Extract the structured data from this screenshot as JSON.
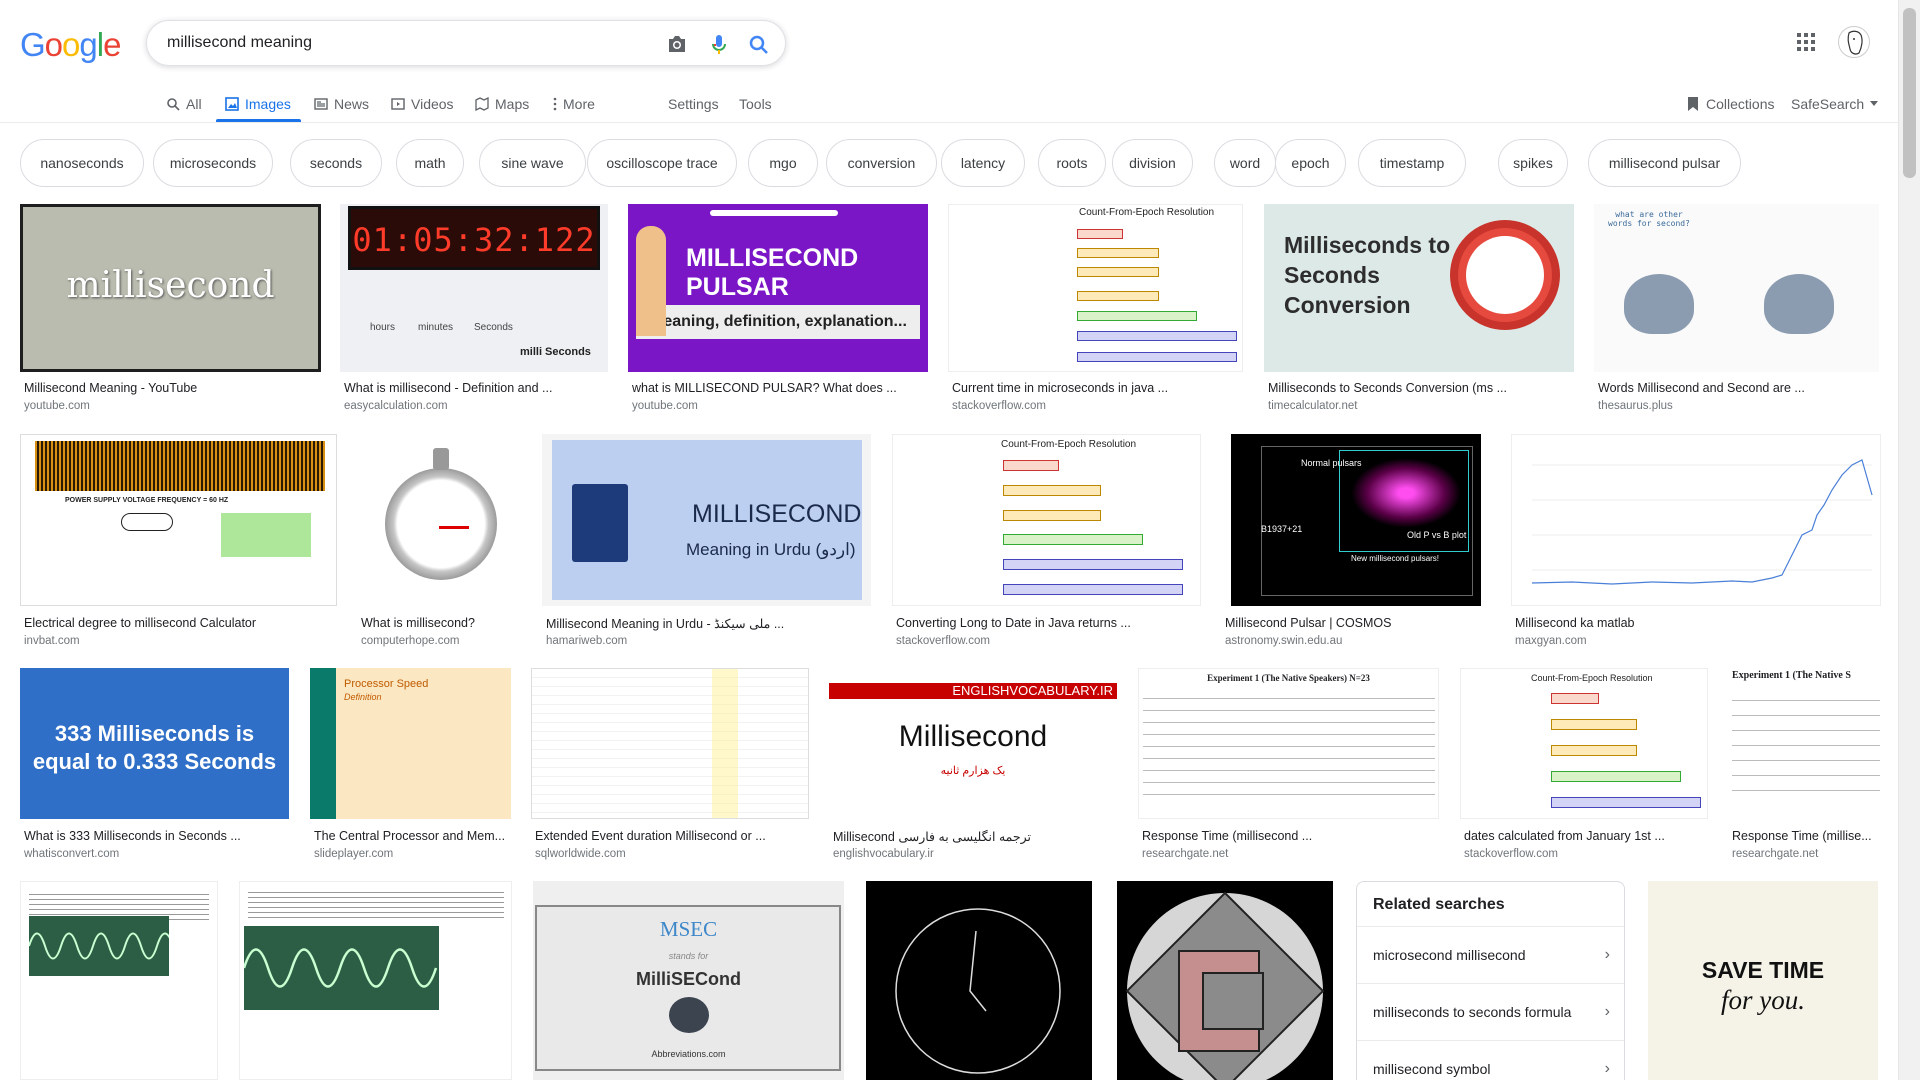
{
  "logo": {
    "text": "Google"
  },
  "search": {
    "query": "millisecond meaning"
  },
  "icons": {
    "camera": "camera-icon",
    "mic": "microphone-icon",
    "search": "search-icon",
    "apps": "apps-grid-icon"
  },
  "tabs": [
    {
      "label": "All",
      "icon": "search-icon"
    },
    {
      "label": "Images",
      "icon": "image-icon",
      "active": true
    },
    {
      "label": "News",
      "icon": "news-icon"
    },
    {
      "label": "Videos",
      "icon": "video-icon"
    },
    {
      "label": "Maps",
      "icon": "map-icon"
    },
    {
      "label": "More",
      "icon": "more-vert-icon"
    }
  ],
  "tools": {
    "settings": "Settings",
    "tools": "Tools",
    "collections": "Collections",
    "safesearch": "SafeSearch"
  },
  "chips": [
    "nanoseconds",
    "microseconds",
    "seconds",
    "math",
    "sine wave",
    "oscilloscope trace",
    "mgo",
    "conversion",
    "latency",
    "roots",
    "division",
    "word",
    "epoch",
    "timestamp",
    "spikes",
    "millisecond pulsar"
  ],
  "results": [
    {
      "caption": "Millisecond Meaning - YouTube",
      "source": "youtube.com",
      "thumb_text": "millisecond"
    },
    {
      "caption": "What is millisecond - Definition and ...",
      "source": "easycalculation.com",
      "thumb_text": "01:05:32:122",
      "sub": [
        "hours",
        "minutes",
        "Seconds",
        "milli Seconds"
      ]
    },
    {
      "caption": "what is MILLISECOND PULSAR? What does ...",
      "source": "youtube.com",
      "thumb_text": "MILLISECOND PULSAR",
      "sub": [
        "meaning, definition, explanation..."
      ]
    },
    {
      "caption": "Current time in microseconds in java ...",
      "source": "stackoverflow.com",
      "thumb_text": "Count-From-Epoch Resolution"
    },
    {
      "caption": "Milliseconds to Seconds Conversion (ms ...",
      "source": "timecalculator.net",
      "thumb_text": "Milliseconds to Seconds Conversion"
    },
    {
      "caption": "Words Millisecond and Second are ...",
      "source": "thesaurus.plus",
      "thumb_text": "what are other words for second?"
    },
    {
      "caption": "Electrical degree to millisecond Calculator",
      "source": "invbat.com",
      "thumb_text": "POWER SUPPLY VOLTAGE FREQUENCY = 60 HZ"
    },
    {
      "caption": "What is millisecond?",
      "source": "computerhope.com",
      "thumb_text": ""
    },
    {
      "caption": "Millisecond Meaning in Urdu - ملی سیکنڈ ...",
      "source": "hamariweb.com",
      "thumb_text": "MILLISECOND",
      "sub": [
        "Meaning in Urdu (اردو)"
      ]
    },
    {
      "caption": "Converting Long to Date in Java returns ...",
      "source": "stackoverflow.com",
      "thumb_text": "Count-From-Epoch Resolution"
    },
    {
      "caption": "Millisecond Pulsar | COSMOS",
      "source": "astronomy.swin.edu.au",
      "thumb_text": "Normal pulsars",
      "sub": [
        "B1937+21",
        "Old P vs B plot",
        "New millisecond pulsars!"
      ]
    },
    {
      "caption": "Millisecond ka matlab",
      "source": "maxgyan.com",
      "thumb_text": ""
    },
    {
      "caption": "What is 333 Milliseconds in Seconds ...",
      "source": "whatisconvert.com",
      "thumb_text": "333 Milliseconds is equal to 0.333 Seconds"
    },
    {
      "caption": "The Central Processor and Mem...",
      "source": "slideplayer.com",
      "thumb_text": "Processor Speed",
      "sub": [
        "Definition"
      ]
    },
    {
      "caption": "Extended Event duration Millisecond or ...",
      "source": "sqlworldwide.com",
      "thumb_text": ""
    },
    {
      "caption": "Millisecond ترجمه انگلیسی به فارسی",
      "source": "englishvocabulary.ir",
      "thumb_text": "Millisecond",
      "sub": [
        "ENGLISHVOCABULARY.IR",
        "یک هزارم ثانیه"
      ]
    },
    {
      "caption": "Response Time (millisecond ...",
      "source": "researchgate.net",
      "thumb_text": "Experiment 1 (The Native Speakers) N=23"
    },
    {
      "caption": "dates calculated from January 1st ...",
      "source": "stackoverflow.com",
      "thumb_text": "Count-From-Epoch Resolution"
    },
    {
      "caption": "Response Time (millise...",
      "source": "researchgate.net",
      "thumb_text": "Experiment 1 (The Native S"
    },
    {
      "caption": "",
      "source": "",
      "thumb_text": ""
    },
    {
      "caption": "",
      "source": "",
      "thumb_text": ""
    },
    {
      "caption": "",
      "source": "",
      "thumb_text": "MSEC",
      "sub": [
        "stands for",
        "MilliSECond",
        "Abbreviations.com"
      ]
    },
    {
      "caption": "",
      "source": "",
      "thumb_text": ""
    },
    {
      "caption": "",
      "source": "",
      "thumb_text": ""
    },
    {
      "caption": "",
      "source": "",
      "thumb_text": "SAVE TIME",
      "sub": [
        "for you."
      ]
    }
  ],
  "related": {
    "title": "Related searches",
    "items": [
      "microsecond millisecond",
      "milliseconds to seconds formula",
      "millisecond symbol"
    ]
  }
}
